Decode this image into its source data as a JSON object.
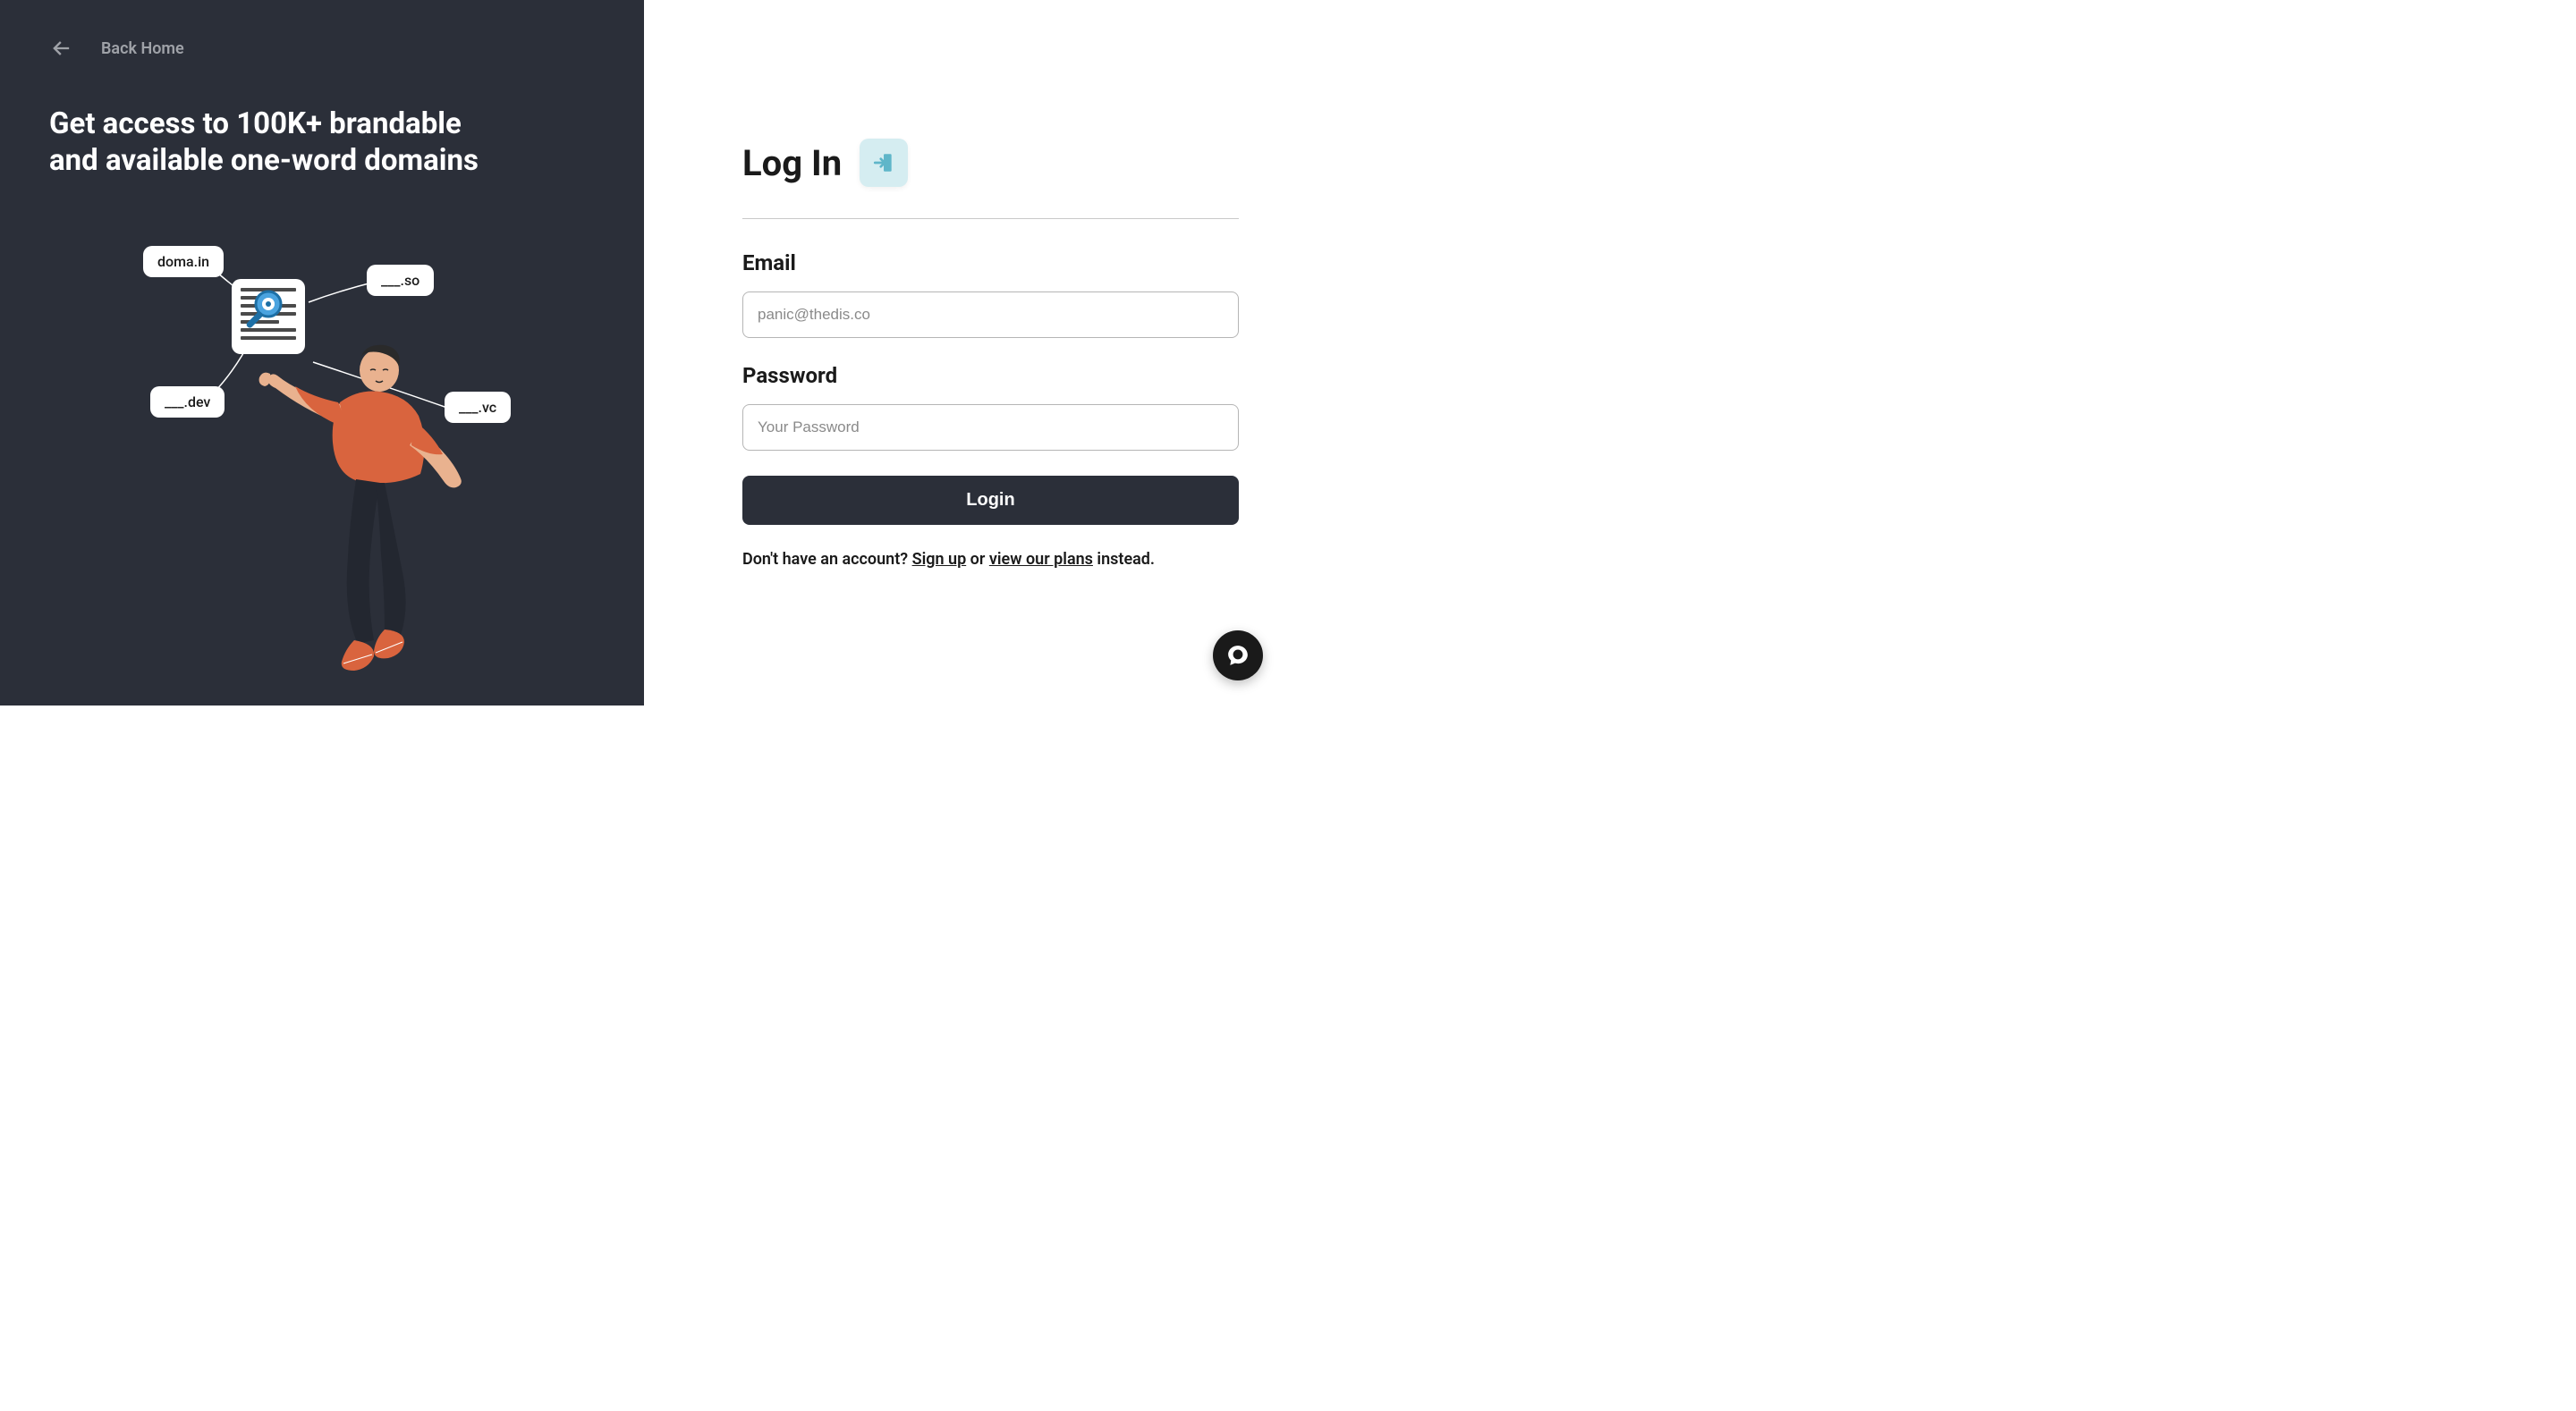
{
  "left": {
    "back_label": "Back Home",
    "headline": "Get access to 100K+ brandable and available one-word domains",
    "bubbles": {
      "b1": "doma.in",
      "b2": "___.so",
      "b3": "___.dev",
      "b4": "___.vc"
    }
  },
  "right": {
    "title": "Log In",
    "email_label": "Email",
    "email_placeholder": "panic@thedis.co",
    "password_label": "Password",
    "password_placeholder": "Your Password",
    "login_button": "Login",
    "footer_prefix": "Don't have an account? ",
    "signup_link": "Sign up",
    "footer_mid": " or ",
    "plans_link": "view our plans",
    "footer_suffix": " instead."
  }
}
